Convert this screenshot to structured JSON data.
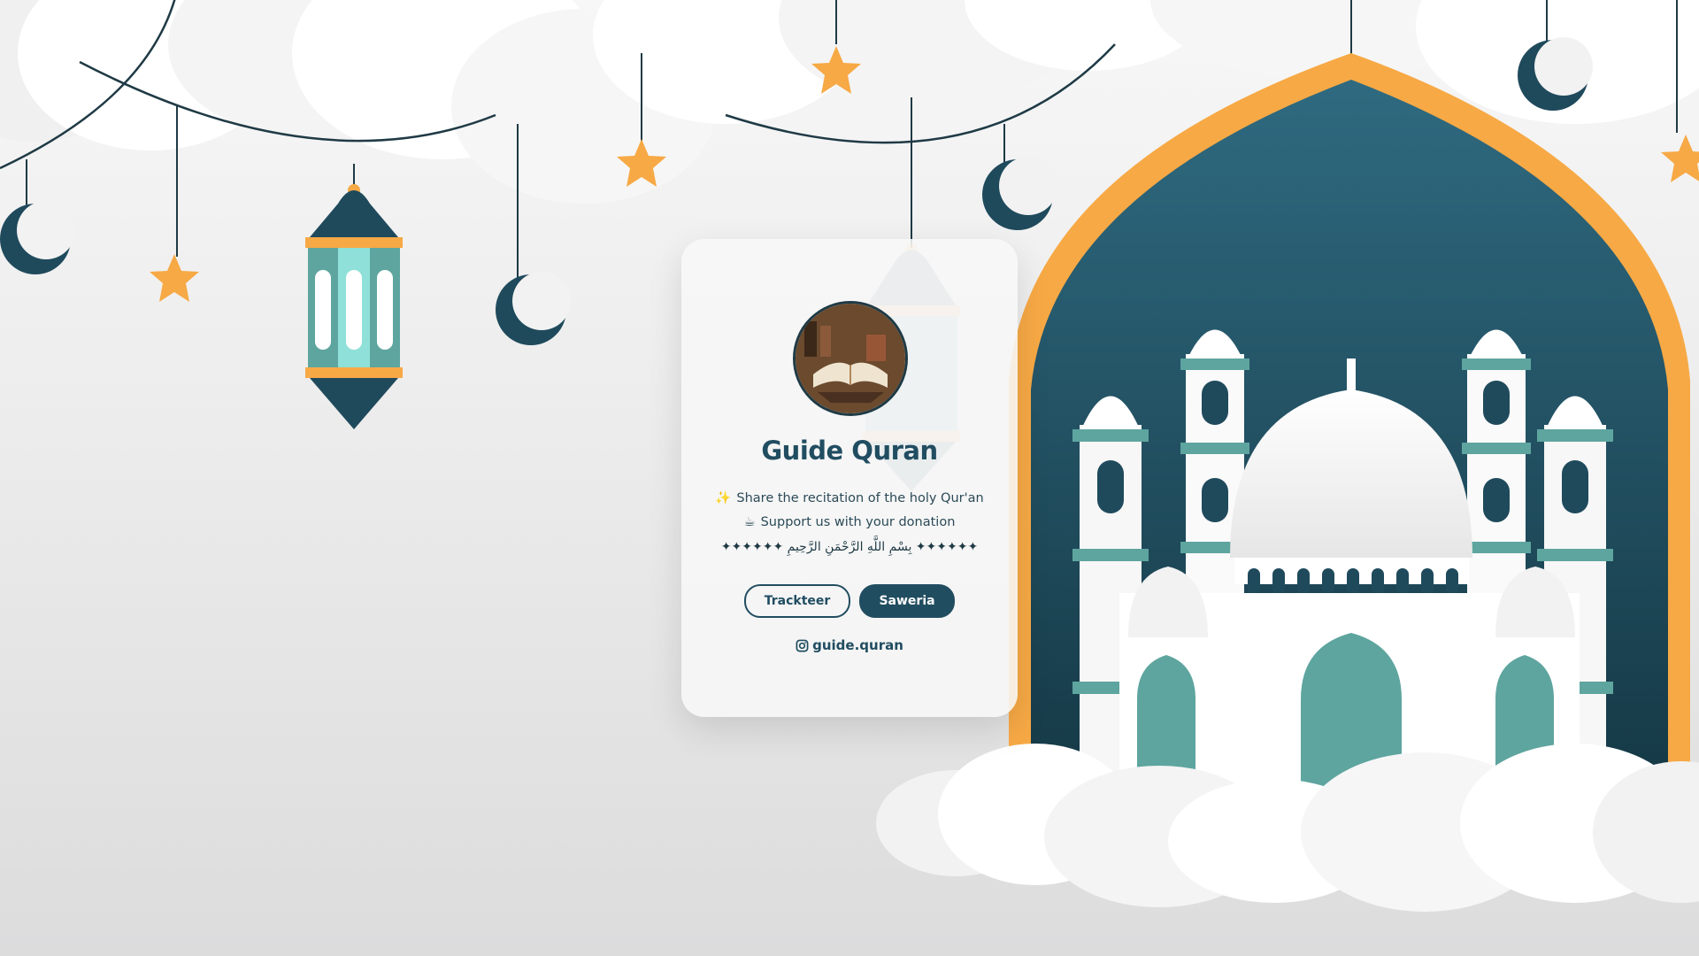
{
  "profile": {
    "name": "Guide Quran",
    "avatar_icon": "open-quran-icon",
    "bio": [
      {
        "emoji": "✨",
        "text": "Share the recitation of the holy Qur'an"
      },
      {
        "emoji": "☕",
        "text": "Support us with your donation"
      }
    ],
    "bismillah": "✦✦✦✦✦✦ بِسْمِ اللَّهِ الرَّحْمَنِ الرَّحِيمِ ✦✦✦✦✦✦"
  },
  "links": [
    {
      "label": "Trackteer"
    },
    {
      "label": "Saweria"
    }
  ],
  "social": {
    "icon": "instagram-icon",
    "handle": "guide.quran"
  },
  "colors": {
    "primary": "#214d61",
    "accent": "#f7a945",
    "teal": "#5ea59f",
    "background": "#ececec"
  }
}
